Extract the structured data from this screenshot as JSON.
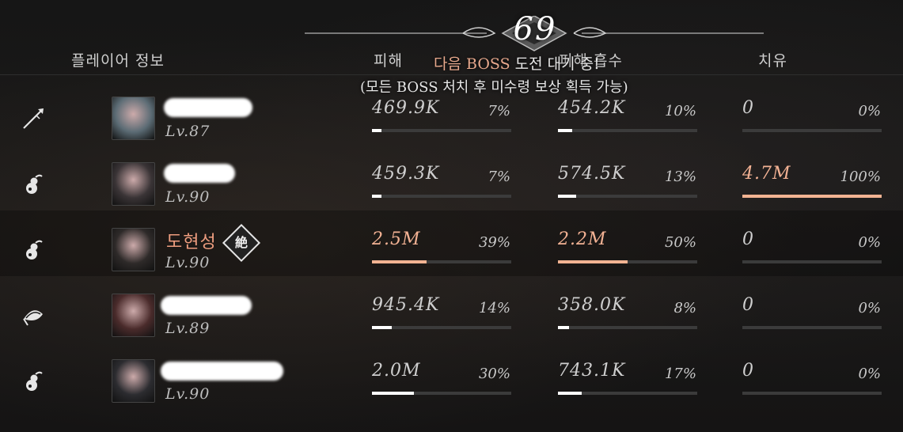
{
  "round": {
    "number": "69"
  },
  "headers": {
    "player_info": "플레이어 정보",
    "damage": "피해",
    "damage_taken": "피해 흡수",
    "healing": "치유"
  },
  "notice": {
    "line1_accent": "다음 BOSS",
    "line1_rest": "도전 대기 중!",
    "line2": "(모든 BOSS 처치 후 미수령 보상 획득 가능)"
  },
  "colors": {
    "accent": "#f2b392",
    "bar_track": "#3b3b3b",
    "bar_fill": "#ffffff"
  },
  "players": [
    {
      "class_icon": "spear-icon",
      "name": "",
      "name_hidden": true,
      "level": "Lv.87",
      "damage": {
        "value": "469.9K",
        "pct": "7%",
        "fraction": 0.07,
        "highlight": false
      },
      "taken": {
        "value": "454.2K",
        "pct": "10%",
        "fraction": 0.1,
        "highlight": false
      },
      "heal": {
        "value": "0",
        "pct": "0%",
        "fraction": 0,
        "highlight": false
      }
    },
    {
      "class_icon": "gourd-icon",
      "name": "",
      "name_hidden": true,
      "level": "Lv.90",
      "damage": {
        "value": "459.3K",
        "pct": "7%",
        "fraction": 0.07,
        "highlight": false
      },
      "taken": {
        "value": "574.5K",
        "pct": "13%",
        "fraction": 0.13,
        "highlight": false
      },
      "heal": {
        "value": "4.7M",
        "pct": "100%",
        "fraction": 1.0,
        "highlight": true
      }
    },
    {
      "class_icon": "gourd-icon",
      "name": "도현성",
      "badge": "絶",
      "name_hidden": false,
      "level": "Lv.90",
      "damage": {
        "value": "2.5M",
        "pct": "39%",
        "fraction": 0.39,
        "highlight": true
      },
      "taken": {
        "value": "2.2M",
        "pct": "50%",
        "fraction": 0.5,
        "highlight": true
      },
      "heal": {
        "value": "0",
        "pct": "0%",
        "fraction": 0,
        "highlight": false
      }
    },
    {
      "class_icon": "fan-icon",
      "name": "",
      "name_hidden": true,
      "level": "Lv.89",
      "damage": {
        "value": "945.4K",
        "pct": "14%",
        "fraction": 0.14,
        "highlight": false
      },
      "taken": {
        "value": "358.0K",
        "pct": "8%",
        "fraction": 0.08,
        "highlight": false
      },
      "heal": {
        "value": "0",
        "pct": "0%",
        "fraction": 0,
        "highlight": false
      }
    },
    {
      "class_icon": "gourd-icon",
      "name": "",
      "name_hidden": true,
      "level": "Lv.90",
      "damage": {
        "value": "2.0M",
        "pct": "30%",
        "fraction": 0.3,
        "highlight": false
      },
      "taken": {
        "value": "743.1K",
        "pct": "17%",
        "fraction": 0.17,
        "highlight": false
      },
      "heal": {
        "value": "0",
        "pct": "0%",
        "fraction": 0,
        "highlight": false
      }
    }
  ]
}
